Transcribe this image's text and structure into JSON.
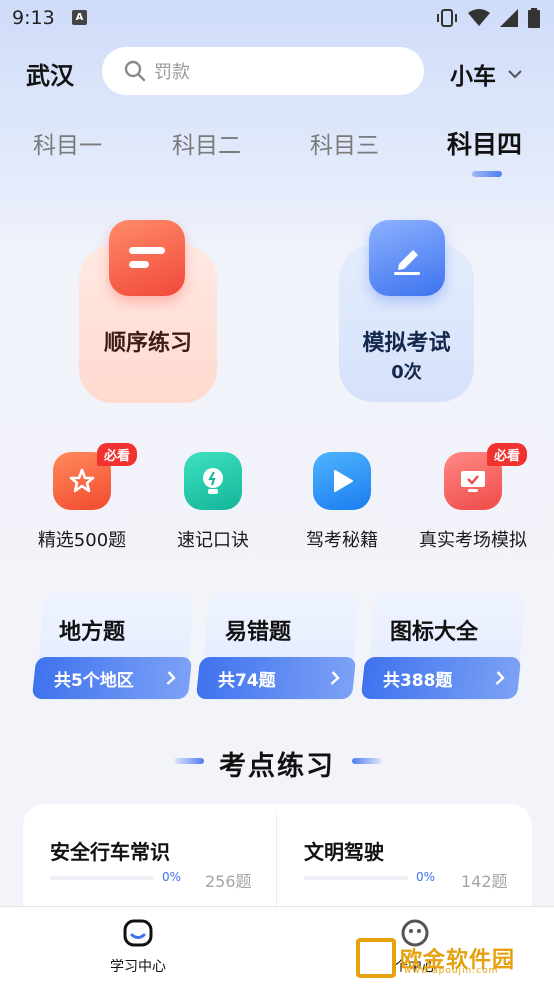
{
  "status_bar": {
    "time": "9:13",
    "notif_letter": "A"
  },
  "header": {
    "city": "武汉",
    "search_placeholder": "罚款",
    "vehicle_type": "小车"
  },
  "tabs": [
    {
      "label": "科目一",
      "active": false
    },
    {
      "label": "科目二",
      "active": false
    },
    {
      "label": "科目三",
      "active": false
    },
    {
      "label": "科目四",
      "active": true
    }
  ],
  "main_cards": {
    "order_practice": {
      "title": "顺序练习",
      "icon": "list-icon"
    },
    "mock_exam": {
      "title": "模拟考试",
      "count": "0次",
      "icon": "pencil-icon"
    }
  },
  "features": [
    {
      "label": "精选500题",
      "badge": "必看",
      "icon": "star-icon"
    },
    {
      "label": "速记口诀",
      "badge": "",
      "icon": "lightbulb-icon"
    },
    {
      "label": "驾考秘籍",
      "badge": "",
      "icon": "play-icon"
    },
    {
      "label": "真实考场模拟",
      "badge": "必看",
      "icon": "monitor-check-icon"
    }
  ],
  "question_cards": [
    {
      "title": "地方题",
      "subtitle": "共5个地区"
    },
    {
      "title": "易错题",
      "subtitle": "共74题"
    },
    {
      "title": "图标大全",
      "subtitle": "共388题"
    }
  ],
  "section": {
    "title": "考点练习"
  },
  "practice_items": [
    {
      "title": "安全行车常识",
      "progress": "0%",
      "count": "256题"
    },
    {
      "title": "文明驾驶",
      "progress": "0%",
      "count": "142题"
    }
  ],
  "bottom_nav": [
    {
      "label": "学习中心",
      "icon": "study-icon"
    },
    {
      "label": "个中心",
      "icon": "profile-icon"
    }
  ],
  "watermark": {
    "text": "欧金软件园",
    "url": "www.apoujin.com"
  },
  "colors": {
    "accent": "#3f72ee",
    "badge_red": "#f2322f",
    "order_red": "#f1483a"
  }
}
